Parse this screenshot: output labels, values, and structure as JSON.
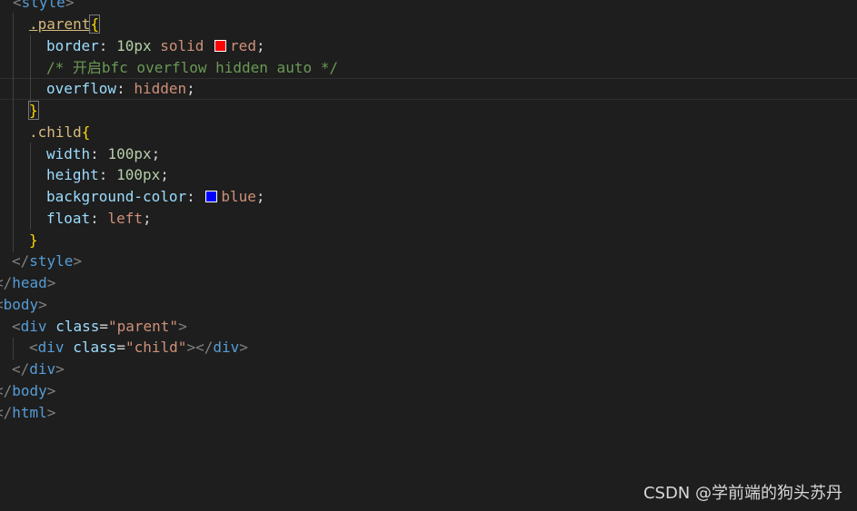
{
  "code": {
    "style_open": "style",
    "parent_selector": ".parent",
    "border_prop": "border",
    "border_num": "10px",
    "border_solid": "solid",
    "border_color": "red",
    "border_swatch": "#ff0000",
    "comment": "/* 开启bfc overflow hidden auto */",
    "overflow_prop": "overflow",
    "overflow_val": "hidden",
    "child_selector": ".child",
    "width_prop": "width",
    "width_val": "100px",
    "height_prop": "height",
    "height_val": "100px",
    "bg_prop": "background-color",
    "bg_color": "blue",
    "bg_swatch": "#0000ff",
    "float_prop": "float",
    "float_val": "left",
    "style_close": "style",
    "head_close": "head",
    "body_open": "body",
    "div_tag": "div",
    "class_attr": "class",
    "parent_str": "\"parent\"",
    "child_str": "\"child\"",
    "body_close": "body",
    "html_close": "html"
  },
  "watermark": "CSDN @学前端的狗头苏丹",
  "colors": {
    "background": "#1e1e1e",
    "tag": "#569cd6",
    "selector": "#d7ba7d",
    "property": "#9cdcfe",
    "number": "#b5cea8",
    "string": "#ce9178",
    "comment": "#6a9955",
    "brace": "#ffd700"
  }
}
